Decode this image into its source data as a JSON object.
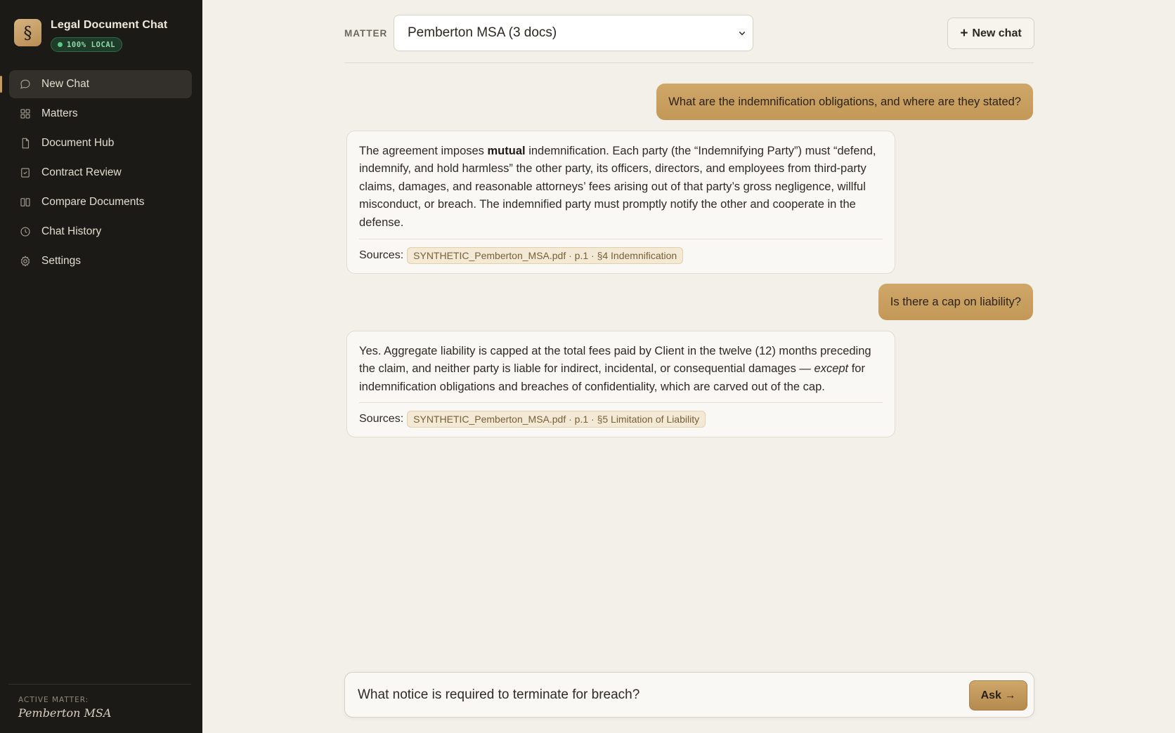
{
  "app": {
    "title": "Legal Document Chat",
    "badge": "100% LOCAL",
    "logo_glyph": "§"
  },
  "sidebar": {
    "items": [
      {
        "label": "New Chat",
        "icon": "chat-bubble-icon",
        "active": true
      },
      {
        "label": "Matters",
        "icon": "grid-icon"
      },
      {
        "label": "Document Hub",
        "icon": "document-icon"
      },
      {
        "label": "Contract Review",
        "icon": "checkbox-icon"
      },
      {
        "label": "Compare Documents",
        "icon": "columns-icon"
      },
      {
        "label": "Chat History",
        "icon": "clock-icon"
      },
      {
        "label": "Settings",
        "icon": "gear-icon"
      }
    ],
    "footer": {
      "label": "ACTIVE MATTER:",
      "value": "Pemberton MSA"
    }
  },
  "topbar": {
    "matter_label": "MATTER",
    "matter_selected": "Pemberton MSA (3 docs)",
    "new_chat_label": "New chat"
  },
  "conversation": {
    "messages": [
      {
        "role": "user",
        "text": "What are the indemnification obligations, and where are they stated?"
      },
      {
        "role": "assistant",
        "text_before": "The agreement imposes ",
        "text_bold": "mutual",
        "text_after": " indemnification. Each party (the “Indemnifying Party”) must “defend, indemnify, and hold harmless” the other party, its officers, directors, and employees from third-party claims, damages, and reasonable attorneys’ fees arising out of that party’s gross negligence, willful misconduct, or breach. The indemnified party must promptly notify the other and cooperate in the defense.",
        "sources_label": "Sources:",
        "source": "SYNTHETIC_Pemberton_MSA.pdf · p.1 · §4 Indemnification"
      },
      {
        "role": "user",
        "text": "Is there a cap on liability?"
      },
      {
        "role": "assistant",
        "text_before": "Yes. Aggregate liability is capped at the total fees paid by Client in the twelve (12) months preceding the claim, and neither party is liable for indirect, incidental, or consequential damages — ",
        "text_italic": "except",
        "text_after": " for indemnification obligations and breaches of confidentiality, which are carved out of the cap.",
        "sources_label": "Sources:",
        "source": "SYNTHETIC_Pemberton_MSA.pdf · p.1 · §5 Limitation of Liability"
      }
    ]
  },
  "composer": {
    "value": "What notice is required to terminate for breach?",
    "ask_label": "Ask →"
  },
  "colors": {
    "sidebar_bg": "#1c1a17",
    "main_bg": "#f3f0e9",
    "accent": "#c79b60",
    "local_badge": "#5cc784"
  }
}
